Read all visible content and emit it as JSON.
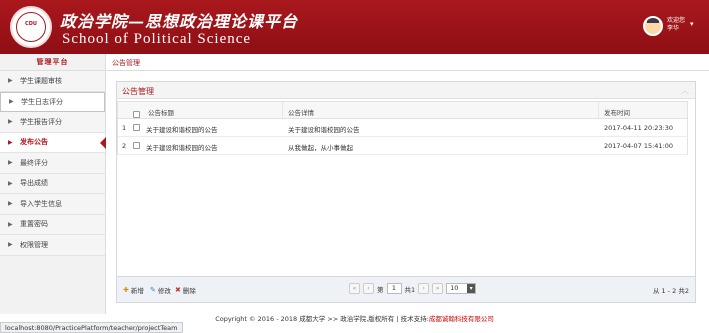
{
  "header": {
    "logo_text": "CDU",
    "title_cn": "政治学院—思想政治理论课平台",
    "title_en": "School of Political Science",
    "user": {
      "greeting": "欢迎您",
      "name": "李华"
    }
  },
  "sidebar": {
    "heading": "管理平台",
    "items": [
      {
        "label": "学生课题审核"
      },
      {
        "label": "学生日志评分"
      },
      {
        "label": "学生报告评分"
      },
      {
        "label": "发布公告"
      },
      {
        "label": "最终评分"
      },
      {
        "label": "导出成绩"
      },
      {
        "label": "导入学生信息"
      },
      {
        "label": "重置密码"
      },
      {
        "label": "权限管理"
      }
    ]
  },
  "breadcrumb": "公告管理",
  "panel": {
    "title": "公告管理",
    "columns": {
      "title": "公告标题",
      "detail": "公告详情",
      "time": "发布时间"
    },
    "rows": [
      {
        "num": "1",
        "title": "关于建设和谐校园的公告",
        "detail": "关于建设和谐校园的公告",
        "time": "2017-04-11 20:23:30"
      },
      {
        "num": "2",
        "title": "关于建设和谐校园的公告",
        "detail": "从我做起，从小事做起",
        "time": "2017-04-07 15:41:00"
      }
    ],
    "toolbar": {
      "add": "新增",
      "edit": "修改",
      "delete": "删除"
    },
    "pager": {
      "page_prefix": "第",
      "page": "1",
      "page_suffix": "共1",
      "page_size": "10",
      "range": "从 1 - 2 共2"
    }
  },
  "footer": {
    "copyright": "Copyright © 2016 - 2018 成都大学 >> 政治学院,版权所有 | 技术支持:",
    "support": "成都诚翰科技有限公司"
  },
  "statusbar": "localhost:8080/PracticePlatform/teacher/projectTeam"
}
